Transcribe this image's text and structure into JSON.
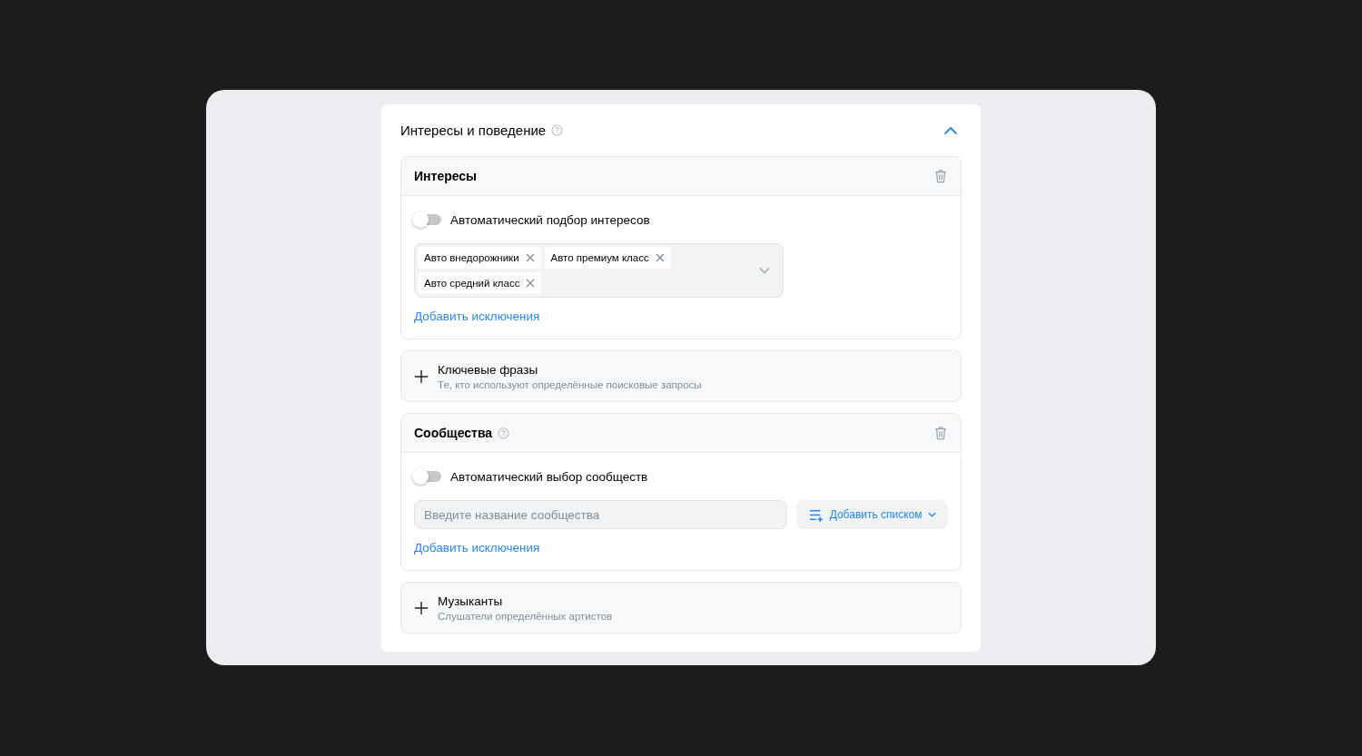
{
  "panel": {
    "title": "Интересы и поведение",
    "help": true,
    "expanded": true
  },
  "sections": [
    {
      "kind": "tags",
      "title": "Интересы",
      "help": false,
      "toggle": {
        "label": "Автоматический подбор интересов",
        "on": false
      },
      "tags": [
        "Авто внедорожники",
        "Авто премиум класс",
        "Авто средний класс"
      ],
      "link": "Добавить исключения"
    },
    {
      "kind": "add",
      "title": "Ключевые фразы",
      "subtitle": "Те, кто используют определённые поисковые запросы"
    },
    {
      "kind": "search",
      "title": "Сообщества",
      "help": true,
      "toggle": {
        "label": "Автоматический выбор сообществ",
        "on": false
      },
      "placeholder": "Введите название сообщества",
      "button": "Добавить списком",
      "link": "Добавить исключения"
    },
    {
      "kind": "add",
      "title": "Музыканты",
      "subtitle": "Слушатели определённых артистов"
    }
  ]
}
